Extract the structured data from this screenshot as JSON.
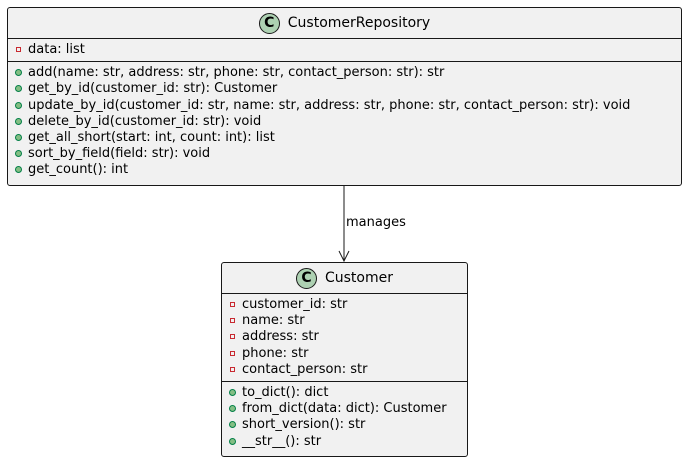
{
  "diagram": {
    "classes": {
      "repository": {
        "stereotype_letter": "C",
        "name": "CustomerRepository",
        "attributes": [
          {
            "visibility": "private",
            "text": "data: list"
          }
        ],
        "methods": [
          {
            "visibility": "public",
            "text": "add(name: str, address: str, phone: str, contact_person: str): str"
          },
          {
            "visibility": "public",
            "text": "get_by_id(customer_id: str): Customer"
          },
          {
            "visibility": "public",
            "text": "update_by_id(customer_id: str, name: str, address: str, phone: str, contact_person: str): void"
          },
          {
            "visibility": "public",
            "text": "delete_by_id(customer_id: str): void"
          },
          {
            "visibility": "public",
            "text": "get_all_short(start: int, count: int): list"
          },
          {
            "visibility": "public",
            "text": "sort_by_field(field: str): void"
          },
          {
            "visibility": "public",
            "text": "get_count(): int"
          }
        ]
      },
      "customer": {
        "stereotype_letter": "C",
        "name": "Customer",
        "attributes": [
          {
            "visibility": "private",
            "text": "customer_id: str"
          },
          {
            "visibility": "private",
            "text": "name: str"
          },
          {
            "visibility": "private",
            "text": "address: str"
          },
          {
            "visibility": "private",
            "text": "phone: str"
          },
          {
            "visibility": "private",
            "text": "contact_person: str"
          }
        ],
        "methods": [
          {
            "visibility": "public",
            "text": "to_dict(): dict"
          },
          {
            "visibility": "public",
            "text": "from_dict(data: dict): Customer"
          },
          {
            "visibility": "public",
            "text": "short_version(): str"
          },
          {
            "visibility": "public",
            "text": "__str__(): str"
          }
        ]
      }
    },
    "relation": {
      "label": "manages"
    }
  }
}
